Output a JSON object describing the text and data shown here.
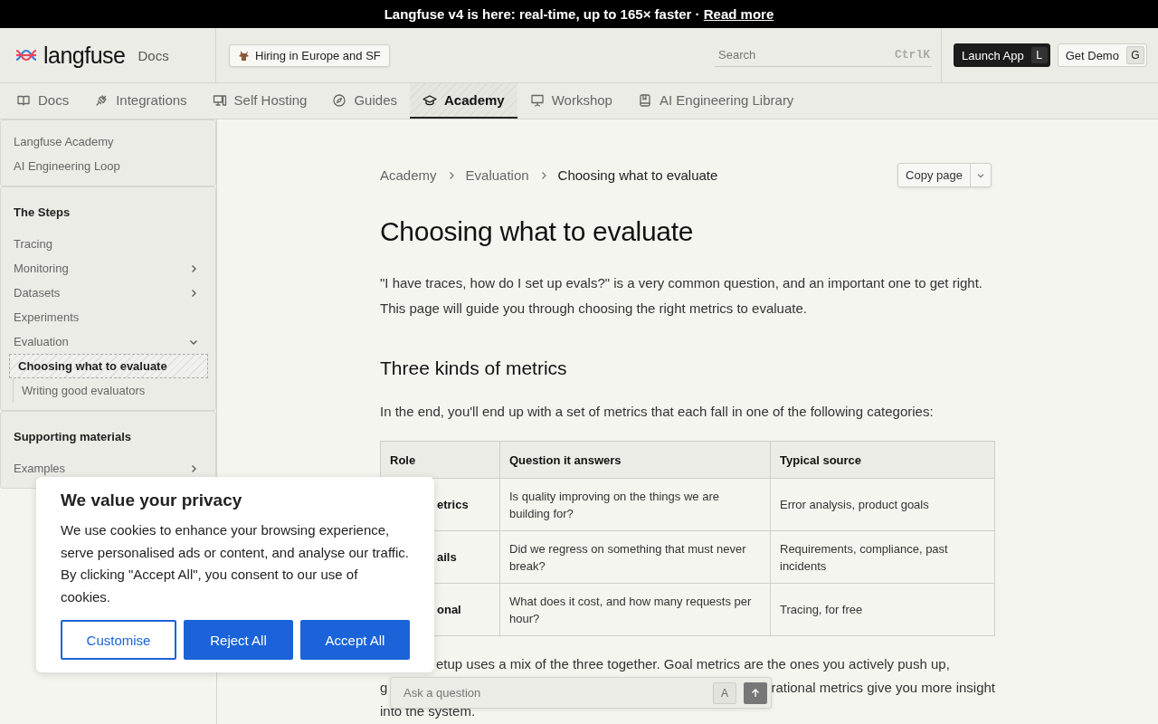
{
  "banner": {
    "text": "Langfuse v4 is here: real-time, up to 165× faster · ",
    "link": "Read more"
  },
  "header": {
    "logo": "langfuse",
    "section": "Docs",
    "hiring": "Hiring in Europe and SF",
    "search": {
      "placeholder": "Search",
      "shortcut": "CtrlK"
    },
    "buttons": [
      {
        "label": "Launch App",
        "key": "L",
        "kind": "primary"
      },
      {
        "label": "Get Demo",
        "key": "G",
        "kind": "secondary"
      }
    ]
  },
  "tabs": [
    {
      "label": "Docs",
      "selected": false
    },
    {
      "label": "Integrations",
      "selected": false
    },
    {
      "label": "Self Hosting",
      "selected": false
    },
    {
      "label": "Guides",
      "selected": false
    },
    {
      "label": "Academy",
      "selected": true
    },
    {
      "label": "Workshop",
      "selected": false
    },
    {
      "label": "AI Engineering Library",
      "selected": false
    }
  ],
  "sidebar": {
    "groups": [
      {
        "items": [
          {
            "label": "Langfuse Academy",
            "kind": "page",
            "selected": false
          },
          {
            "label": "AI Engineering Loop",
            "kind": "page",
            "selected": false
          }
        ]
      },
      {
        "heading": "The Steps",
        "items": [
          {
            "label": "Tracing",
            "kind": "page",
            "selected": false
          },
          {
            "label": "Monitoring",
            "kind": "section",
            "expanded": false,
            "selected": false
          },
          {
            "label": "Datasets",
            "kind": "section",
            "expanded": false,
            "selected": false
          },
          {
            "label": "Experiments",
            "kind": "page",
            "selected": false
          },
          {
            "label": "Evaluation",
            "kind": "section",
            "expanded": true,
            "selected": false,
            "children": [
              {
                "label": "Choosing what to evaluate",
                "kind": "page",
                "selected": true
              },
              {
                "label": "Writing good evaluators",
                "kind": "page",
                "selected": false
              }
            ]
          }
        ]
      },
      {
        "heading": "Supporting materials",
        "items": [
          {
            "label": "Examples",
            "kind": "section",
            "expanded": false,
            "selected": false
          }
        ]
      }
    ]
  },
  "breadcrumb": [
    "Academy",
    "Evaluation",
    "Choosing what to evaluate"
  ],
  "copy_button": "Copy page",
  "title": "Choosing what to evaluate",
  "intro": "\"I have traces, how do I set up evals?\" is a very common question, and an important one to get right. This page will guide you through choosing the right metrics to evaluate.",
  "section_heading": "Three kinds of metrics",
  "lead": "In the end, you'll end up with a set of metrics that each fall in one of the following categories:",
  "table": {
    "columns": [
      "Role",
      "Question it answers",
      "Typical source"
    ],
    "rows": [
      [
        "etrics",
        "Is quality improving on the things we are building for?",
        "Error analysis, product goals"
      ],
      [
        "ails",
        "Did we regress on something that must never break?",
        "Requirements, compliance, past incidents"
      ],
      [
        "onal",
        "What does it cost, and how many requests per hour?",
        "Tracing, for free"
      ]
    ]
  },
  "after_lines": [
    [
      "etup uses a mix of the three together. Goal metrics are the ones you actively push up,"
    ],
    [
      "g",
      "rational metrics give you more insight"
    ],
    [
      "into the system."
    ]
  ],
  "cookie": {
    "title": "We value your privacy",
    "text": "We use cookies to enhance your browsing experience, serve personalised ads or content, and analyse our traffic. By clicking \"Accept All\", you consent to our use of cookies.",
    "buttons": [
      {
        "label": "Customise",
        "kind": "outline"
      },
      {
        "label": "Reject All",
        "kind": "solid"
      },
      {
        "label": "Accept All",
        "kind": "solid"
      }
    ]
  },
  "ask": {
    "placeholder": "Ask a question",
    "key": "A"
  }
}
